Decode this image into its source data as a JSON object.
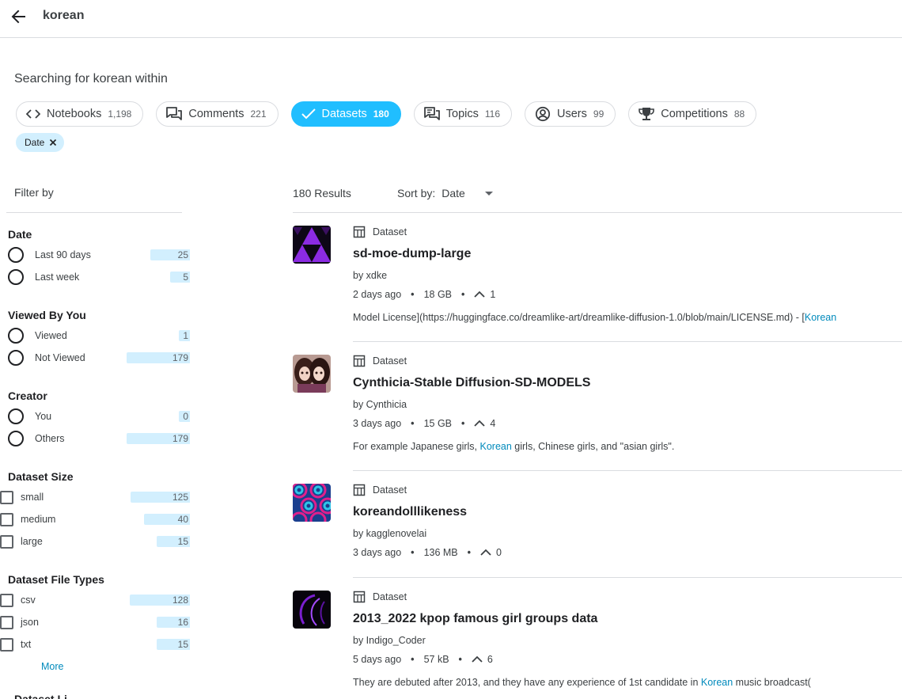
{
  "header": {
    "query": "korean"
  },
  "search": {
    "label": "Searching for korean within"
  },
  "tabs": [
    {
      "label": "Notebooks",
      "count": "1,198",
      "icon": "code-icon"
    },
    {
      "label": "Comments",
      "count": "221",
      "icon": "comments-icon"
    },
    {
      "label": "Datasets",
      "count": "180",
      "icon": "check-icon"
    },
    {
      "label": "Topics",
      "count": "116",
      "icon": "topics-icon"
    },
    {
      "label": "Users",
      "count": "99",
      "icon": "user-icon"
    },
    {
      "label": "Competitions",
      "count": "88",
      "icon": "trophy-icon"
    }
  ],
  "active_filter": {
    "label": "Date"
  },
  "sidebar": {
    "filter_by": "Filter by",
    "groups": [
      {
        "title": "Date",
        "options": [
          {
            "label": "Last 90 days",
            "count": "25"
          },
          {
            "label": "Last week",
            "count": "5"
          }
        ]
      },
      {
        "title": "Viewed By You",
        "options": [
          {
            "label": "Viewed",
            "count": "1"
          },
          {
            "label": "Not Viewed",
            "count": "179"
          }
        ]
      },
      {
        "title": "Creator",
        "options": [
          {
            "label": "You",
            "count": "0"
          },
          {
            "label": "Others",
            "count": "179"
          }
        ]
      },
      {
        "title": "Dataset Size",
        "options": [
          {
            "label": "small",
            "count": "125"
          },
          {
            "label": "medium",
            "count": "40"
          },
          {
            "label": "large",
            "count": "15"
          }
        ]
      },
      {
        "title": "Dataset File Types",
        "options": [
          {
            "label": "csv",
            "count": "128"
          },
          {
            "label": "json",
            "count": "16"
          },
          {
            "label": "txt",
            "count": "15"
          }
        ]
      }
    ],
    "more": "More",
    "next_group_title": "Dataset Li"
  },
  "results": {
    "count_label": "180 Results",
    "sort_label": "Sort by:",
    "sort_value": "Date",
    "items": [
      {
        "type": "Dataset",
        "title": "sd-moe-dump-large",
        "by": "by xdke",
        "age": "2 days ago",
        "size": "18 GB",
        "votes": "1",
        "snippet_pre": "Model License](https://huggingface.co/dreamlike-art/dreamlike-diffusion-1.0/blob/main/LICENSE.md) - [",
        "snippet_hl": "Korean",
        "snippet_post": ""
      },
      {
        "type": "Dataset",
        "title": "Cynthicia-Stable Diffusion-SD-MODELS",
        "by": "by Cynthicia",
        "age": "3 days ago",
        "size": "15 GB",
        "votes": "4",
        "snippet_pre": "For example Japanese girls, ",
        "snippet_hl": "Korean",
        "snippet_post": " girls, Chinese girls, and \"asian girls\"."
      },
      {
        "type": "Dataset",
        "title": "koreandolllikeness",
        "by": "by kagglenovelai",
        "age": "3 days ago",
        "size": "136 MB",
        "votes": "0",
        "snippet_pre": "",
        "snippet_hl": "",
        "snippet_post": ""
      },
      {
        "type": "Dataset",
        "title": "2013_2022 kpop famous girl groups data",
        "by": "by Indigo_Coder",
        "age": "5 days ago",
        "size": "57 kB",
        "votes": "6",
        "snippet_pre": "They are debuted after 2013, and they have any experience of 1st candidate in ",
        "snippet_hl": "Korean",
        "snippet_post": " music broadcast("
      }
    ]
  }
}
